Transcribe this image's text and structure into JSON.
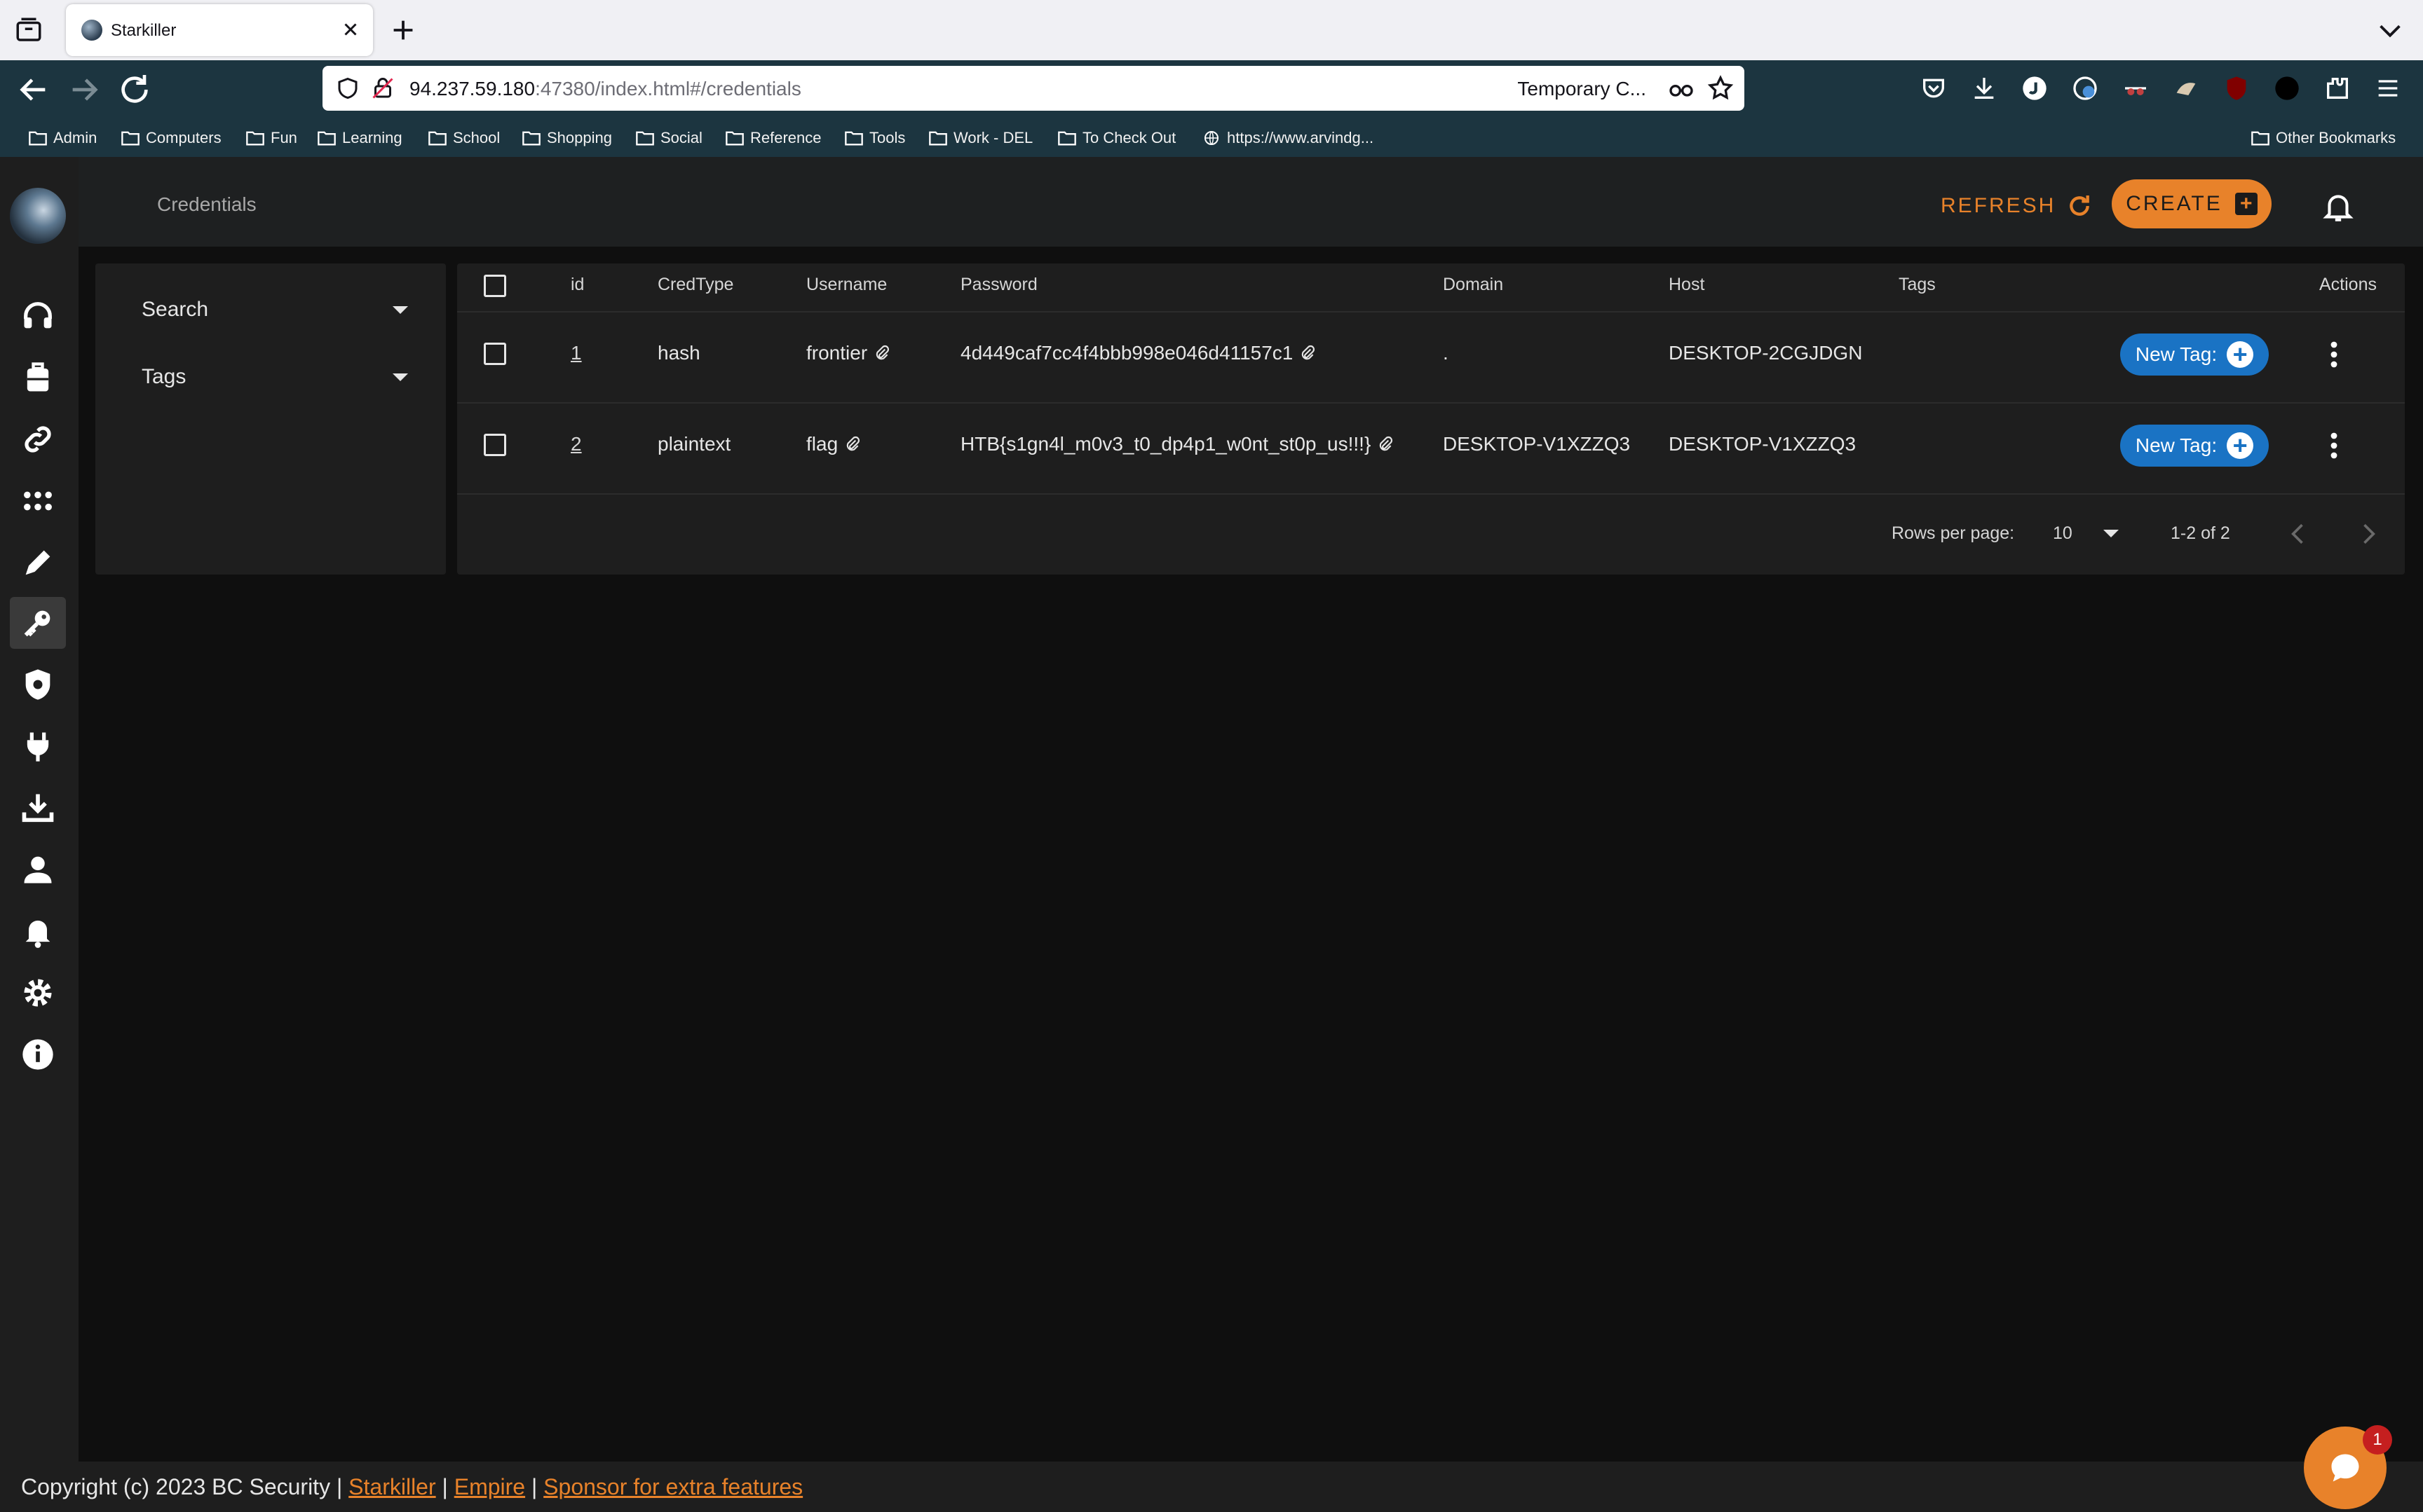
{
  "browser": {
    "tab_title": "Starkiller",
    "url_host": "94.237.59.180",
    "url_rest": ":47380/index.html#/credentials",
    "container_label": "Temporary C...",
    "bookmarks": [
      "Admin",
      "Computers",
      "Fun",
      "Learning",
      "School",
      "Shopping",
      "Social",
      "Reference",
      "Tools",
      "Work - DEL",
      "To Check Out",
      "https://www.arvindg..."
    ],
    "other_bookmarks": "Other Bookmarks"
  },
  "app": {
    "page_title": "Credentials",
    "refresh_label": "REFRESH",
    "create_label": "CREATE",
    "sidebar_icons": [
      "headphones-icon",
      "briefcase-icon",
      "link-icon",
      "modules-grid-icon",
      "edit-pen-icon",
      "key-icon",
      "shield-gear-icon",
      "plug-icon",
      "download-icon",
      "user-icon",
      "bell-icon",
      "settings-gear-icon",
      "info-icon"
    ],
    "active_sidebar": "key-icon"
  },
  "filters": {
    "search_label": "Search",
    "tags_label": "Tags"
  },
  "table": {
    "headers": {
      "id": "id",
      "credtype": "CredType",
      "username": "Username",
      "password": "Password",
      "domain": "Domain",
      "host": "Host",
      "tags": "Tags",
      "actions": "Actions"
    },
    "rows": [
      {
        "id": "1",
        "credtype": "hash",
        "username": "frontier",
        "password": "4d449caf7cc4f4bbb998e046d41157c1",
        "domain": ".",
        "host": "DESKTOP-2CGJDGN",
        "new_tag_label": "New Tag:"
      },
      {
        "id": "2",
        "credtype": "plaintext",
        "username": "flag",
        "password": "HTB{s1gn4l_m0v3_t0_dp4p1_w0nt_st0p_us!!!}",
        "domain": "DESKTOP-V1XZZQ3",
        "host": "DESKTOP-V1XZZQ3",
        "new_tag_label": "New Tag:"
      }
    ],
    "pagination": {
      "rows_per_page_label": "Rows per page:",
      "rows_per_page_value": "10",
      "range_text": "1-2 of 2"
    }
  },
  "footer": {
    "copyright": "Copyright (c) 2023 BC Security |",
    "link_starkiller": "Starkiller",
    "sep1": "|",
    "link_empire": "Empire",
    "sep2": "|",
    "link_sponsor": "Sponsor for extra features"
  },
  "chat": {
    "badge_count": "1"
  },
  "colors": {
    "accent": "#e8822a",
    "tag_button": "#1a73c4",
    "browser_toolbar": "#1c3540"
  }
}
